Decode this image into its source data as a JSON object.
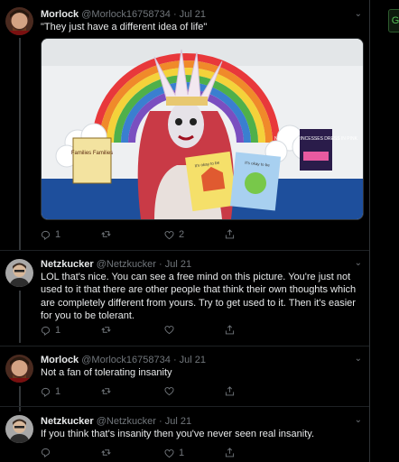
{
  "tweets": [
    {
      "name": "Morlock",
      "handle": "@Morlock16758734",
      "time": "Jul 21",
      "text": "\"They just have a different idea of life\"",
      "replies": "1",
      "retweets": "",
      "likes": "2"
    },
    {
      "name": "Netzkucker",
      "handle": "@Netzkucker",
      "time": "Jul 21",
      "text": "LOL that's nice. You can see a free mind on this picture. You're just not used to it that there are other people that think their own thoughts which are completely different from yours. Try to get used to it. Then it's easier for you to be tolerant.",
      "replies": "1",
      "retweets": "",
      "likes": ""
    },
    {
      "name": "Morlock",
      "handle": "@Morlock16758734",
      "time": "Jul 21",
      "text": "Not a fan of tolerating insanity",
      "replies": "1",
      "retweets": "",
      "likes": ""
    },
    {
      "name": "Netzkucker",
      "handle": "@Netzkucker",
      "time": "Jul 21",
      "text": "If you think that's insanity then you've never seen real insanity.",
      "replies": "",
      "retweets": "",
      "likes": "1"
    }
  ],
  "media": {
    "book_left": "Families Families",
    "book_center_left": "It's okay to be",
    "book_center_right": "It's okay to be",
    "book_right": "NOT ALL PRINCESSES DRESS IN PINK"
  },
  "separator": "·",
  "side_chip": "G",
  "icons": {
    "reply": "reply-icon",
    "retweet": "retweet-icon",
    "like": "heart-icon",
    "share": "share-icon",
    "more": "chevron-down-icon"
  }
}
